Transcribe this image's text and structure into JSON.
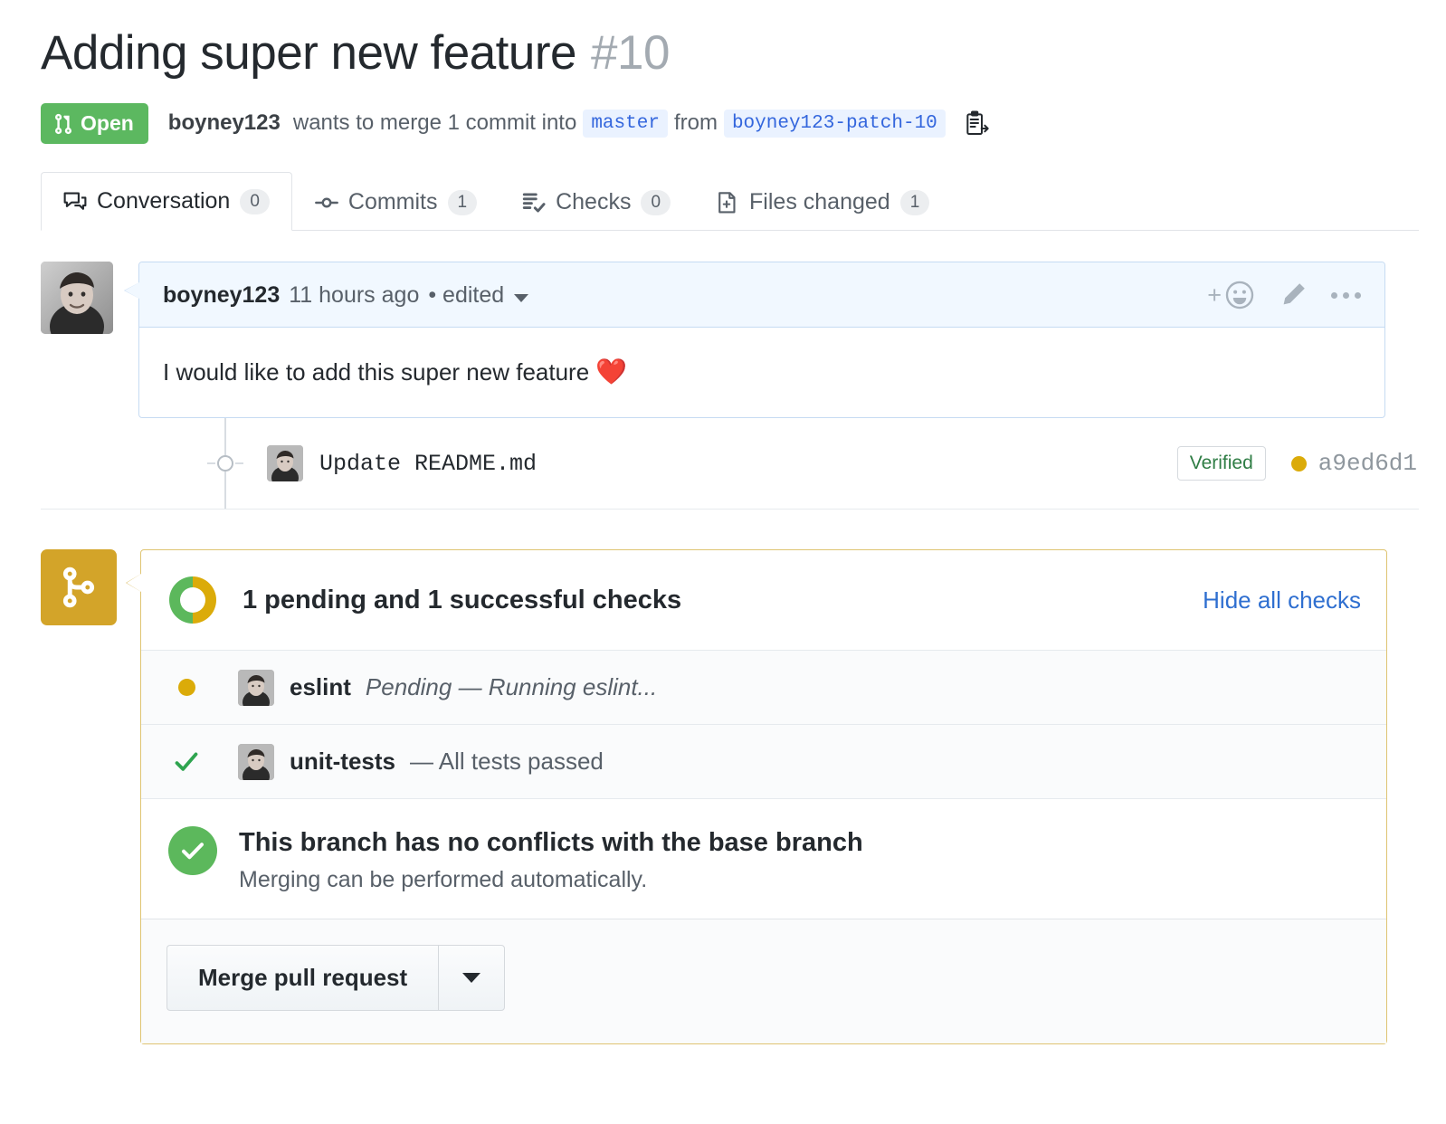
{
  "header": {
    "title": "Adding super new feature",
    "number": "#10",
    "state": "Open",
    "state_icon": "git-pull-request-icon",
    "state_color": "#5cb860",
    "author": "boyney123",
    "byline_pre": "wants to merge 1 commit into",
    "base_branch": "master",
    "byline_mid": "from",
    "head_branch": "boyney123-patch-10",
    "copy_icon": "copy-branch-icon"
  },
  "tabs": [
    {
      "label": "Conversation",
      "count": "0",
      "icon": "comment-discussion-icon",
      "active": true
    },
    {
      "label": "Commits",
      "count": "1",
      "icon": "git-commit-icon",
      "active": false
    },
    {
      "label": "Checks",
      "count": "0",
      "icon": "checklist-icon",
      "active": false
    },
    {
      "label": "Files changed",
      "count": "1",
      "icon": "file-diff-icon",
      "active": false
    }
  ],
  "comment": {
    "author": "boyney123",
    "timestamp": "11 hours ago",
    "edited": "• edited",
    "body": "I would like to add this super new feature",
    "body_emoji": "❤️",
    "actions": [
      {
        "name": "add-reaction-icon",
        "label": "+"
      },
      {
        "name": "edit-comment-icon",
        "label": ""
      },
      {
        "name": "comment-menu-icon",
        "label": ""
      }
    ]
  },
  "commit": {
    "message": "Update README.md",
    "verified_label": "Verified",
    "verified_color": "#2f7d45",
    "sha": "a9ed6d1",
    "sha_dot_color": "#dbab09"
  },
  "merge_box": {
    "icon": "git-merge-icon",
    "icon_bg": "#d3a429",
    "border_color": "#dfc472",
    "checks_summary": "1 pending and 1 successful checks",
    "hide_checks_label": "Hide all checks",
    "donut": {
      "success_color": "#5cb85c",
      "pending_color": "#dbab09",
      "success_pct": 50,
      "pending_pct": 50
    },
    "checks": [
      {
        "status": "pending",
        "status_icon": "pending-dot-icon",
        "status_color": "#dbab09",
        "name": "eslint",
        "description": "Pending — Running eslint...",
        "italic": true
      },
      {
        "status": "success",
        "status_icon": "check-icon",
        "status_color": "#2ea44f",
        "name": "unit-tests",
        "description": "— All tests passed",
        "italic": false
      }
    ],
    "merge_status": {
      "icon": "success-check-circle-icon",
      "icon_color": "#5cb85c",
      "title": "This branch has no conflicts with the base branch",
      "subtitle": "Merging can be performed automatically."
    },
    "merge_button": {
      "label": "Merge pull request",
      "dropdown_icon": "chevron-down-icon"
    }
  }
}
